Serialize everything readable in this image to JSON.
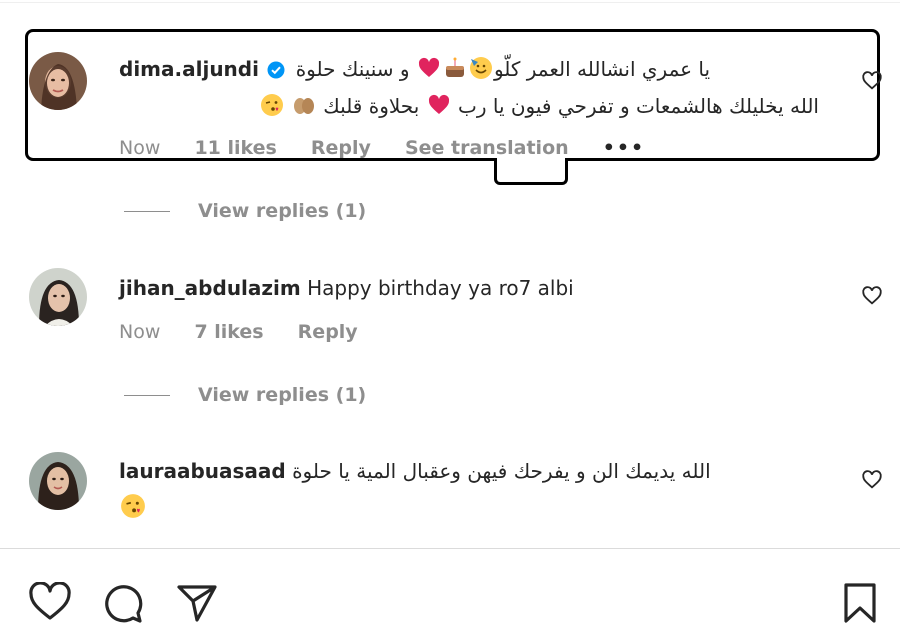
{
  "comments": [
    {
      "username": "dima.aljundi",
      "verified": true,
      "line1": "يا عمري انشالله العمر كلّو🥳🎂❤️ و سنينك حلوة",
      "line1_text_a": "يا عمري انشالله العمر كلّو",
      "line1_text_b": "و سنينك حلوة",
      "line2_text": "الله يخليلك هالشمعات و تفرحي فيون يا رب",
      "line2_text_b": "بحلاوة قلبك",
      "time": "Now",
      "likes": "11 likes",
      "reply": "Reply",
      "see_translation": "See translation",
      "more": "•••",
      "view_replies": "View replies (1)"
    },
    {
      "username": "jihan_abdulazim",
      "text": "Happy birthday ya ro7 albi",
      "time": "Now",
      "likes": "7 likes",
      "reply": "Reply",
      "view_replies": "View replies (1)"
    },
    {
      "username": "lauraabuasaad",
      "text": "الله يديمك الن و يفرحك فيهن وعقبال المية يا حلوة",
      "time": "",
      "likes": ""
    }
  ],
  "icons": {
    "like": "heart-icon",
    "comment": "comment-icon",
    "share": "send-icon",
    "save": "bookmark-icon",
    "verified": "verified-badge-icon"
  },
  "colors": {
    "text": "#262626",
    "muted": "#8e8e8e",
    "verified": "#0095f6",
    "heart_emoji": "#e0245e"
  }
}
